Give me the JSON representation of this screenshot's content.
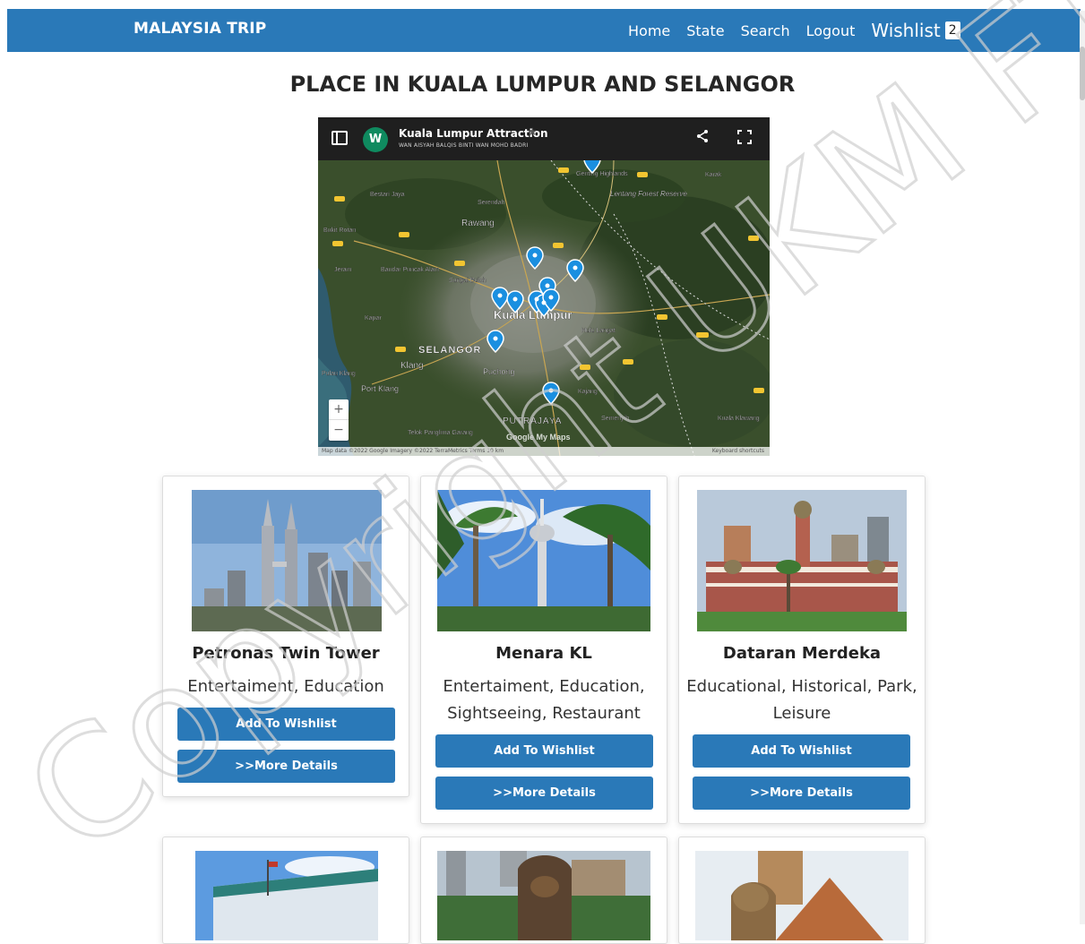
{
  "navbar": {
    "brand": "MALAYSIA TRIP",
    "links": [
      "Home",
      "State",
      "Search",
      "Logout"
    ],
    "wishlist_label": "Wishlist",
    "wishlist_count": "2",
    "bg_color": "#2a79b8"
  },
  "page": {
    "title": "PLACE IN KUALA LUMPUR AND SELANGOR"
  },
  "map": {
    "title": "Kuala Lumpur Attraction",
    "avatar_letter": "W",
    "author": "WAN AISYAH BALQIS BINTI WAN MOHD BADRI",
    "labels": {
      "city_main": "Kuala Lumpur",
      "selangor": "SELANGOR",
      "rawang": "Rawang",
      "klang": "Klang",
      "puchong": "Puchong",
      "port_klang": "Port Klang",
      "putrajaya": "PUTRAJAYA",
      "kajang": "Kajang",
      "hulu_langat": "Hulu Langat",
      "sungai_buloh": "Sungai Buloh",
      "genting": "Genting Highlands",
      "lentang": "Lentang Forest Reserve",
      "karak": "Karak",
      "serendah": "Serendah",
      "bestari_jaya": "Bestari Jaya",
      "bukit_rotan": "Bukit Rotan",
      "jeram": "Jeram",
      "bandar_puncak": "Bandar Puncak Alam",
      "kapar": "Kapar",
      "pulau_klang": "Pulau Klang",
      "semenyih": "Semenyih",
      "kuala_klawang": "Kuala Klawang",
      "telok_panglima": "Telok Panglima Garang"
    },
    "footer_left": "Map data ©2022 Google Imagery ©2022 TerraMetrics   Terms   10 km",
    "footer_right": "Keyboard shortcuts",
    "google_mark": "Google My Maps",
    "zoom_in": "+",
    "zoom_out": "−"
  },
  "cards": [
    {
      "name": "Petronas Twin Tower",
      "categories": "Entertaiment, Education",
      "add_label": "Add To Wishlist",
      "details_label": ">>More Details"
    },
    {
      "name": "Menara KL",
      "categories": "Entertaiment, Education, Sightseeing, Restaurant",
      "add_label": "Add To Wishlist",
      "details_label": ">>More Details"
    },
    {
      "name": "Dataran Merdeka",
      "categories": "Educational, Historical, Park, Leisure",
      "add_label": "Add To Wishlist",
      "details_label": ">>More Details"
    }
  ],
  "watermark": "Copyright UKM FTSM"
}
